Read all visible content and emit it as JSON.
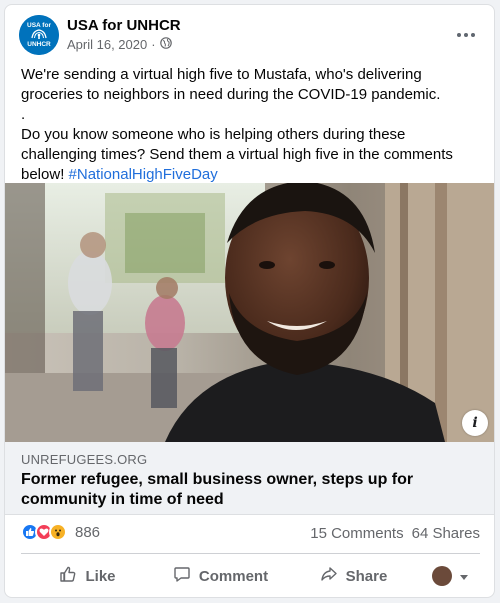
{
  "post": {
    "page_name": "USA for UNHCR",
    "date": "April 16, 2020",
    "separator": "·",
    "avatar_text_top": "USA for",
    "avatar_text_bottom": "UNHCR",
    "text_line1": "We're sending a virtual high five to Mustafa, who's delivering groceries to neighbors in need during the COVID-19 pandemic.",
    "text_dot": ".",
    "text_line2": "Do you know someone who is helping others during these challenging times? Send them a virtual high five in the comments below! ",
    "hashtag": "#NationalHighFiveDay"
  },
  "link_preview": {
    "domain": "UNREFUGEES.ORG",
    "title": "Former refugee, small business owner, steps up for community in time of need",
    "info_icon": "i"
  },
  "stats": {
    "reaction_count": "886",
    "comments": "15 Comments",
    "shares": "64 Shares",
    "reaction_icons": [
      "like-icon",
      "love-icon",
      "wow-icon"
    ]
  },
  "actions": {
    "like": "Like",
    "comment": "Comment",
    "share": "Share"
  },
  "colors": {
    "brand_blue": "#0072bc",
    "like_blue": "#1877f2",
    "love_red": "#f33e58",
    "wow_yellow": "#f7b125",
    "hashtag_blue": "#216fdb"
  }
}
